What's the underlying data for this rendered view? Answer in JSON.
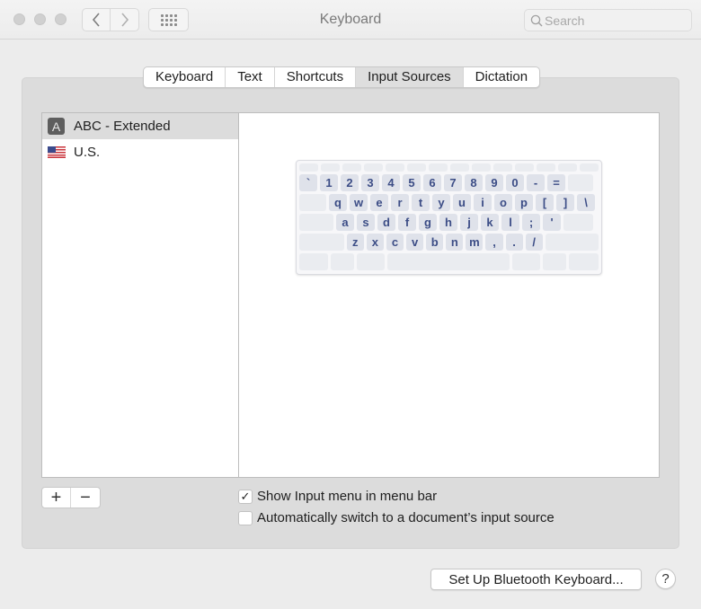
{
  "window": {
    "title": "Keyboard",
    "search_placeholder": "Search",
    "nav": {
      "back_icon": "chevron-left-icon",
      "forward_icon": "chevron-right-icon",
      "grid_icon": "grid-icon"
    }
  },
  "tabs": [
    {
      "label": "Keyboard",
      "active": false
    },
    {
      "label": "Text",
      "active": false
    },
    {
      "label": "Shortcuts",
      "active": false
    },
    {
      "label": "Input Sources",
      "active": true
    },
    {
      "label": "Dictation",
      "active": false
    }
  ],
  "input_sources": [
    {
      "label": "ABC - Extended",
      "icon": "abc-icon",
      "icon_text": "A",
      "selected": true
    },
    {
      "label": "U.S.",
      "icon": "us-flag-icon",
      "selected": false
    }
  ],
  "keyboard": {
    "rows": [
      [
        "`",
        "1",
        "2",
        "3",
        "4",
        "5",
        "6",
        "7",
        "8",
        "9",
        "0",
        "-",
        "="
      ],
      [
        "q",
        "w",
        "e",
        "r",
        "t",
        "y",
        "u",
        "i",
        "o",
        "p",
        "[",
        "]",
        "\\"
      ],
      [
        "a",
        "s",
        "d",
        "f",
        "g",
        "h",
        "j",
        "k",
        "l",
        ";",
        "'"
      ],
      [
        "z",
        "x",
        "c",
        "v",
        "b",
        "n",
        "m",
        ",",
        ".",
        "/"
      ]
    ]
  },
  "list_buttons": {
    "add_label": "+",
    "remove_label": "−"
  },
  "options": {
    "show_input_menu": {
      "label": "Show Input menu in menu bar",
      "checked": true,
      "check_glyph": "✓"
    },
    "auto_switch": {
      "label": "Automatically switch to a document’s input source",
      "checked": false,
      "check_glyph": ""
    }
  },
  "footer": {
    "bluetooth_button": "Set Up Bluetooth Keyboard...",
    "help_label": "?"
  }
}
